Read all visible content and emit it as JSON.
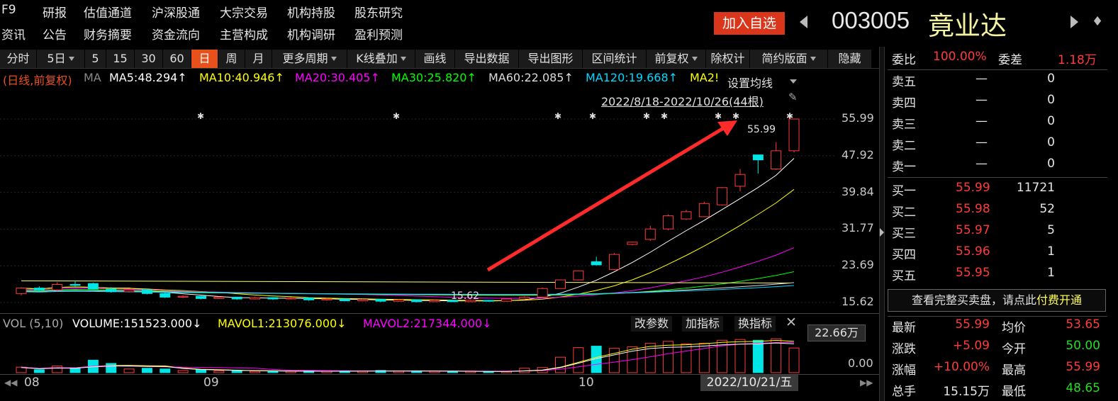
{
  "top_nav": {
    "row1": [
      "F9",
      "研报",
      "估值通道",
      "沪深股通",
      "大宗交易",
      "机构持股",
      "股东研究"
    ],
    "row2": [
      "资讯",
      "公告",
      "财务摘要",
      "资金流向",
      "主营构成",
      "机构调研",
      "盈利预测"
    ]
  },
  "stock": {
    "add_watch": "加入自选",
    "code": "003005",
    "name": "竟业达"
  },
  "toolbar": {
    "items": [
      "分时",
      "5日",
      "5",
      "15",
      "30",
      "60",
      "日",
      "周",
      "月",
      "更多周期",
      "K线叠加",
      "画线",
      "导出数据",
      "导出图形",
      "区间统计",
      "前复权",
      "除权计",
      "简约版面",
      "隐藏"
    ],
    "active": "日"
  },
  "ma_bar": {
    "prefix": "(日线,前复权)",
    "ma_label": "MA",
    "ma5": "MA5:48.294↑",
    "ma10": "MA10:40.946↑",
    "ma20": "MA20:30.405↑",
    "ma30": "MA30:25.820↑",
    "ma60": "MA60:22.085↑",
    "ma120": "MA120:19.668↑",
    "ma2x": "MA2!",
    "set_ma": "设置均线",
    "range": "2022/8/18-2022/10/26(44根)"
  },
  "colors": {
    "ma5": "#ffffff",
    "ma10": "#ffff00",
    "ma20": "#ff00ff",
    "ma30": "#00ff00",
    "ma60": "#dcdcdc",
    "ma120": "#00d8ff",
    "up": "#ff3b3b",
    "down": "#00e5e5",
    "accent": "#e8501c"
  },
  "price_axis": [
    "55.99",
    "47.92",
    "39.84",
    "31.77",
    "23.69",
    "15.62"
  ],
  "chart_annotations": {
    "high_label": "55.99",
    "low_label": "15.62"
  },
  "volume": {
    "label": "VOL (5,10)",
    "volume": "VOLUME:151523.000↓",
    "mavol1": "MAVOL1:213076.000↓",
    "mavol2": "MAVOL2:217344.000↓",
    "btn_params": "改参数",
    "btn_add": "加指标",
    "btn_switch": "换指标",
    "axis_top": "22.66万",
    "axis_bottom": "0.00"
  },
  "date_axis": [
    "08",
    "09",
    "10"
  ],
  "cursor_date": "2022/10/21/五",
  "order_book": {
    "weibi_label": "委比",
    "weibi": "100.00%",
    "weicha_label": "委差",
    "weicha": "1.18万",
    "sells": [
      {
        "label": "卖五",
        "price": "—",
        "vol": "0"
      },
      {
        "label": "卖四",
        "price": "—",
        "vol": "0"
      },
      {
        "label": "卖三",
        "price": "—",
        "vol": "0"
      },
      {
        "label": "卖二",
        "price": "—",
        "vol": "0"
      },
      {
        "label": "卖一",
        "price": "—",
        "vol": "0"
      }
    ],
    "buys": [
      {
        "label": "买一",
        "price": "55.99",
        "vol": "11721"
      },
      {
        "label": "买二",
        "price": "55.98",
        "vol": "52"
      },
      {
        "label": "买三",
        "price": "55.97",
        "vol": "5"
      },
      {
        "label": "买四",
        "price": "55.96",
        "vol": "1"
      },
      {
        "label": "买五",
        "price": "55.95",
        "vol": "1"
      }
    ],
    "promo_text": "查看完整买卖盘，请点此",
    "promo_link": "付费开通"
  },
  "quote": {
    "rows": [
      {
        "l1": "最新",
        "v1": "55.99",
        "l2": "均价",
        "v2": "53.65",
        "c1": "red",
        "c2": "red"
      },
      {
        "l1": "涨跌",
        "v1": "+5.09",
        "l2": "今开",
        "v2": "50.00",
        "c1": "red",
        "c2": "green"
      },
      {
        "l1": "涨幅",
        "v1": "+10.00%",
        "l2": "最高",
        "v2": "55.99",
        "c1": "red",
        "c2": "red"
      },
      {
        "l1": "总手",
        "v1": "15.15万",
        "l2": "最低",
        "v2": "48.65",
        "c1": "white",
        "c2": "green"
      }
    ]
  },
  "candles": [
    {
      "o": 17.6,
      "c": 18.8,
      "h": 19.0,
      "l": 17.2,
      "v": 0.15
    },
    {
      "o": 18.8,
      "c": 18.4,
      "h": 19.2,
      "l": 18.0,
      "v": 0.08
    },
    {
      "o": 18.4,
      "c": 19.6,
      "h": 20.1,
      "l": 18.1,
      "v": 0.18
    },
    {
      "o": 19.6,
      "c": 19.4,
      "h": 20.5,
      "l": 19.0,
      "v": 0.12
    },
    {
      "o": 19.8,
      "c": 18.6,
      "h": 20.0,
      "l": 18.4,
      "v": 0.34
    },
    {
      "o": 18.6,
      "c": 18.0,
      "h": 19.0,
      "l": 17.8,
      "v": 0.25
    },
    {
      "o": 18.0,
      "c": 18.4,
      "h": 18.7,
      "l": 17.8,
      "v": 0.1
    },
    {
      "o": 18.4,
      "c": 17.6,
      "h": 18.6,
      "l": 17.4,
      "v": 0.12
    },
    {
      "o": 17.6,
      "c": 16.8,
      "h": 17.8,
      "l": 16.6,
      "v": 0.1
    },
    {
      "o": 16.8,
      "c": 17.0,
      "h": 17.2,
      "l": 16.6,
      "v": 0.06
    },
    {
      "o": 17.0,
      "c": 16.5,
      "h": 17.1,
      "l": 16.3,
      "v": 0.08
    },
    {
      "o": 16.5,
      "c": 16.8,
      "h": 17.0,
      "l": 16.4,
      "v": 0.05
    },
    {
      "o": 16.8,
      "c": 16.4,
      "h": 16.9,
      "l": 16.2,
      "v": 0.05
    },
    {
      "o": 16.4,
      "c": 16.7,
      "h": 16.9,
      "l": 16.3,
      "v": 0.04
    },
    {
      "o": 16.7,
      "c": 16.4,
      "h": 16.8,
      "l": 16.2,
      "v": 0.04
    },
    {
      "o": 16.4,
      "c": 16.6,
      "h": 16.8,
      "l": 16.3,
      "v": 0.04
    },
    {
      "o": 16.6,
      "c": 16.2,
      "h": 16.7,
      "l": 16.0,
      "v": 0.05
    },
    {
      "o": 16.2,
      "c": 16.4,
      "h": 16.6,
      "l": 16.0,
      "v": 0.04
    },
    {
      "o": 16.4,
      "c": 16.0,
      "h": 16.5,
      "l": 15.9,
      "v": 0.05
    },
    {
      "o": 16.0,
      "c": 16.3,
      "h": 16.5,
      "l": 15.9,
      "v": 0.04
    },
    {
      "o": 16.3,
      "c": 15.9,
      "h": 16.4,
      "l": 15.7,
      "v": 0.06
    },
    {
      "o": 15.9,
      "c": 16.2,
      "h": 16.4,
      "l": 15.8,
      "v": 0.04
    },
    {
      "o": 16.2,
      "c": 15.8,
      "h": 16.3,
      "l": 15.62,
      "v": 0.05
    },
    {
      "o": 15.8,
      "c": 16.1,
      "h": 16.3,
      "l": 15.7,
      "v": 0.04
    },
    {
      "o": 16.1,
      "c": 15.8,
      "h": 16.2,
      "l": 15.7,
      "v": 0.03
    },
    {
      "o": 15.8,
      "c": 16.1,
      "h": 16.3,
      "l": 15.7,
      "v": 0.04
    },
    {
      "o": 16.1,
      "c": 15.9,
      "h": 16.2,
      "l": 15.8,
      "v": 0.02
    },
    {
      "o": 15.9,
      "c": 16.4,
      "h": 16.6,
      "l": 15.8,
      "v": 0.04
    },
    {
      "o": 16.4,
      "c": 16.8,
      "h": 17.0,
      "l": 16.2,
      "v": 0.12
    },
    {
      "o": 16.8,
      "c": 18.7,
      "h": 18.9,
      "l": 16.8,
      "v": 0.14
    },
    {
      "o": 18.7,
      "c": 20.6,
      "h": 20.6,
      "l": 18.7,
      "v": 0.42
    },
    {
      "o": 20.6,
      "c": 22.6,
      "h": 22.7,
      "l": 20.5,
      "v": 0.68
    },
    {
      "o": 24.6,
      "c": 23.9,
      "h": 25.7,
      "l": 23.8,
      "v": 0.72
    },
    {
      "o": 22.9,
      "c": 26.2,
      "h": 26.5,
      "l": 22.8,
      "v": 0.66
    },
    {
      "o": 28.4,
      "c": 28.9,
      "h": 29.0,
      "l": 28.2,
      "v": 0.7
    },
    {
      "o": 29.5,
      "c": 31.8,
      "h": 32.5,
      "l": 29.2,
      "v": 0.8
    },
    {
      "o": 31.8,
      "c": 34.7,
      "h": 35.0,
      "l": 31.5,
      "v": 0.85
    },
    {
      "o": 34.0,
      "c": 35.6,
      "h": 36.0,
      "l": 33.8,
      "v": 0.78
    },
    {
      "o": 34.5,
      "c": 37.4,
      "h": 37.8,
      "l": 34.4,
      "v": 0.8
    },
    {
      "o": 37.1,
      "c": 40.9,
      "h": 41.0,
      "l": 37.0,
      "v": 0.88
    },
    {
      "o": 41.2,
      "c": 43.8,
      "h": 45.0,
      "l": 40.1,
      "v": 0.9
    },
    {
      "o": 48.1,
      "c": 47.0,
      "h": 48.1,
      "l": 44.0,
      "v": 0.88
    },
    {
      "o": 45.0,
      "c": 49.0,
      "h": 50.9,
      "l": 44.8,
      "v": 0.92
    },
    {
      "o": 49.0,
      "c": 55.99,
      "h": 55.99,
      "l": 48.65,
      "v": 0.67
    }
  ]
}
